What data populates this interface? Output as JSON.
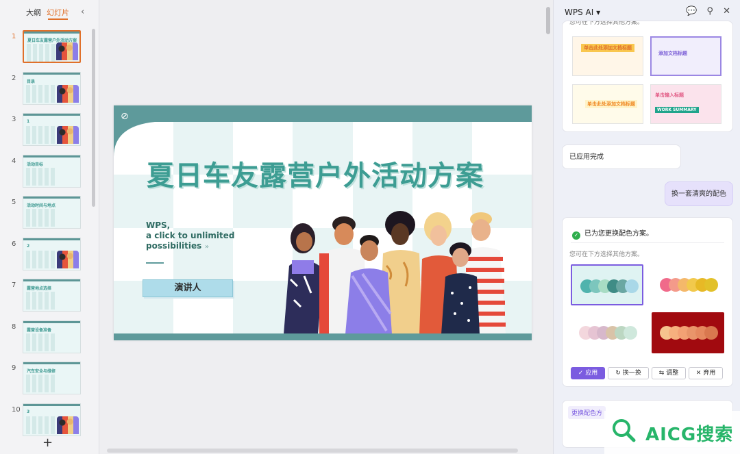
{
  "left_panel": {
    "tabs": [
      {
        "label": "大纲"
      },
      {
        "label": "幻灯片"
      }
    ],
    "collapse_glyph": "‹",
    "add_glyph": "+",
    "slides": [
      {
        "num": "1",
        "text": "夏日车友露营户外活动方案"
      },
      {
        "num": "2",
        "text": "目录"
      },
      {
        "num": "3",
        "text": "1"
      },
      {
        "num": "4",
        "text": "活动目标"
      },
      {
        "num": "5",
        "text": "活动时间与地点"
      },
      {
        "num": "6",
        "text": "2"
      },
      {
        "num": "7",
        "text": "露营地点选择"
      },
      {
        "num": "8",
        "text": "露营设备准备"
      },
      {
        "num": "9",
        "text": "汽车安全与维修"
      },
      {
        "num": "10",
        "text": "3"
      }
    ]
  },
  "slide": {
    "title": "夏日车友露营户外活动方案",
    "subtitle_line1": "WPS,",
    "subtitle_line2": "a click to unlimited",
    "subtitle_line3": "possibilities",
    "arrow": "»",
    "presenter": "演讲人"
  },
  "ai_panel": {
    "name": "WPS AI",
    "header_icons": [
      "chat-icon",
      "pin-icon",
      "close-icon"
    ],
    "card1_cut_text": "您可在下方选择其他方案。",
    "templates": [
      {
        "label": "单击此处添加文档标题"
      },
      {
        "label": "添加文档标题"
      },
      {
        "label": "单击此处添加文档标题"
      },
      {
        "label": "单击输入标题",
        "label2": "WORK SUMMARY"
      }
    ],
    "msg_done": "已应用完成",
    "msg_user": "换一套清爽的配色",
    "result_text": "已为您更换配色方案。",
    "hint": "您可在下方选择其他方案。",
    "schemes": [
      {
        "colors": [
          "#4fb3ad",
          "#7cc6bd",
          "#a8dcc4",
          "#3f8c86",
          "#6aa7a3",
          "#a9d8e8"
        ]
      },
      {
        "colors": [
          "#f06a8a",
          "#f49a8a",
          "#f4b86a",
          "#f2c94c",
          "#e7b926",
          "#e2c12a"
        ]
      },
      {
        "colors": [
          "#f3d7dd",
          "#e6c4d3",
          "#d7b8cb",
          "#d9c3a8",
          "#bcd7c2",
          "#cfe8dc"
        ]
      },
      {
        "colors": [
          "#f6c38e",
          "#f6b07e",
          "#f3a174",
          "#e9956a",
          "#e5895f",
          "#d9784f"
        ]
      }
    ],
    "buttons": {
      "apply": "✓ 应用",
      "swap": "↻ 换一换",
      "adjust": "⇆ 调整",
      "discard": "✕ 弃用"
    },
    "card3_tag": "更换配色方"
  },
  "watermark": "AICG搜索",
  "colors": {
    "accent_orange": "#e0702a",
    "slide_teal": "#5e9a9b",
    "title_teal": "#3d9d93",
    "ai_purple": "#7b5ce0",
    "watermark_green": "#27b56a"
  }
}
